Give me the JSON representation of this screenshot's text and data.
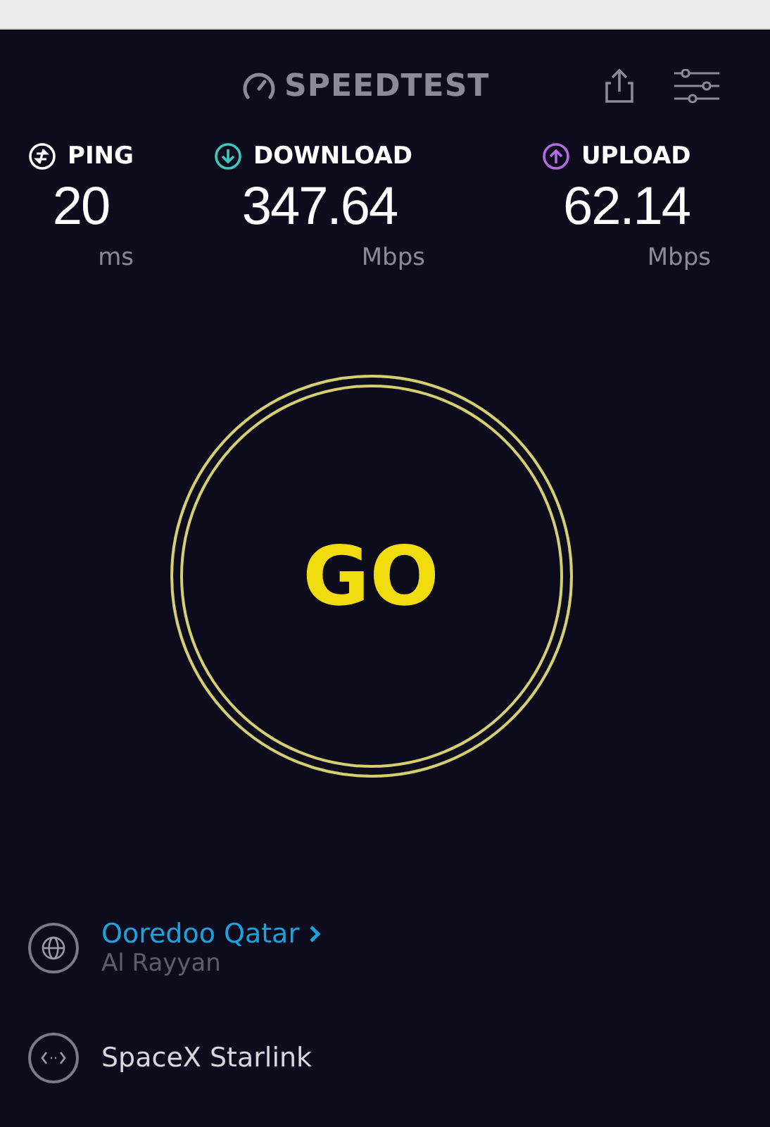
{
  "header": {
    "logo": "SPEEDTEST"
  },
  "stats": [
    {
      "kind": "ping",
      "label": "PING",
      "value": "20",
      "unit": "ms",
      "color": "#ffffff"
    },
    {
      "kind": "download",
      "label": "DOWNLOAD",
      "value": "347.64",
      "unit": "Mbps",
      "color": "#3ec8c0"
    },
    {
      "kind": "upload",
      "label": "UPLOAD",
      "value": "62.14",
      "unit": "Mbps",
      "color": "#b36ae2"
    }
  ],
  "go_button": {
    "label": "GO"
  },
  "provider": {
    "name": "Ooredoo Qatar",
    "location": "Al Rayyan"
  },
  "server": {
    "name": "SpaceX Starlink"
  }
}
